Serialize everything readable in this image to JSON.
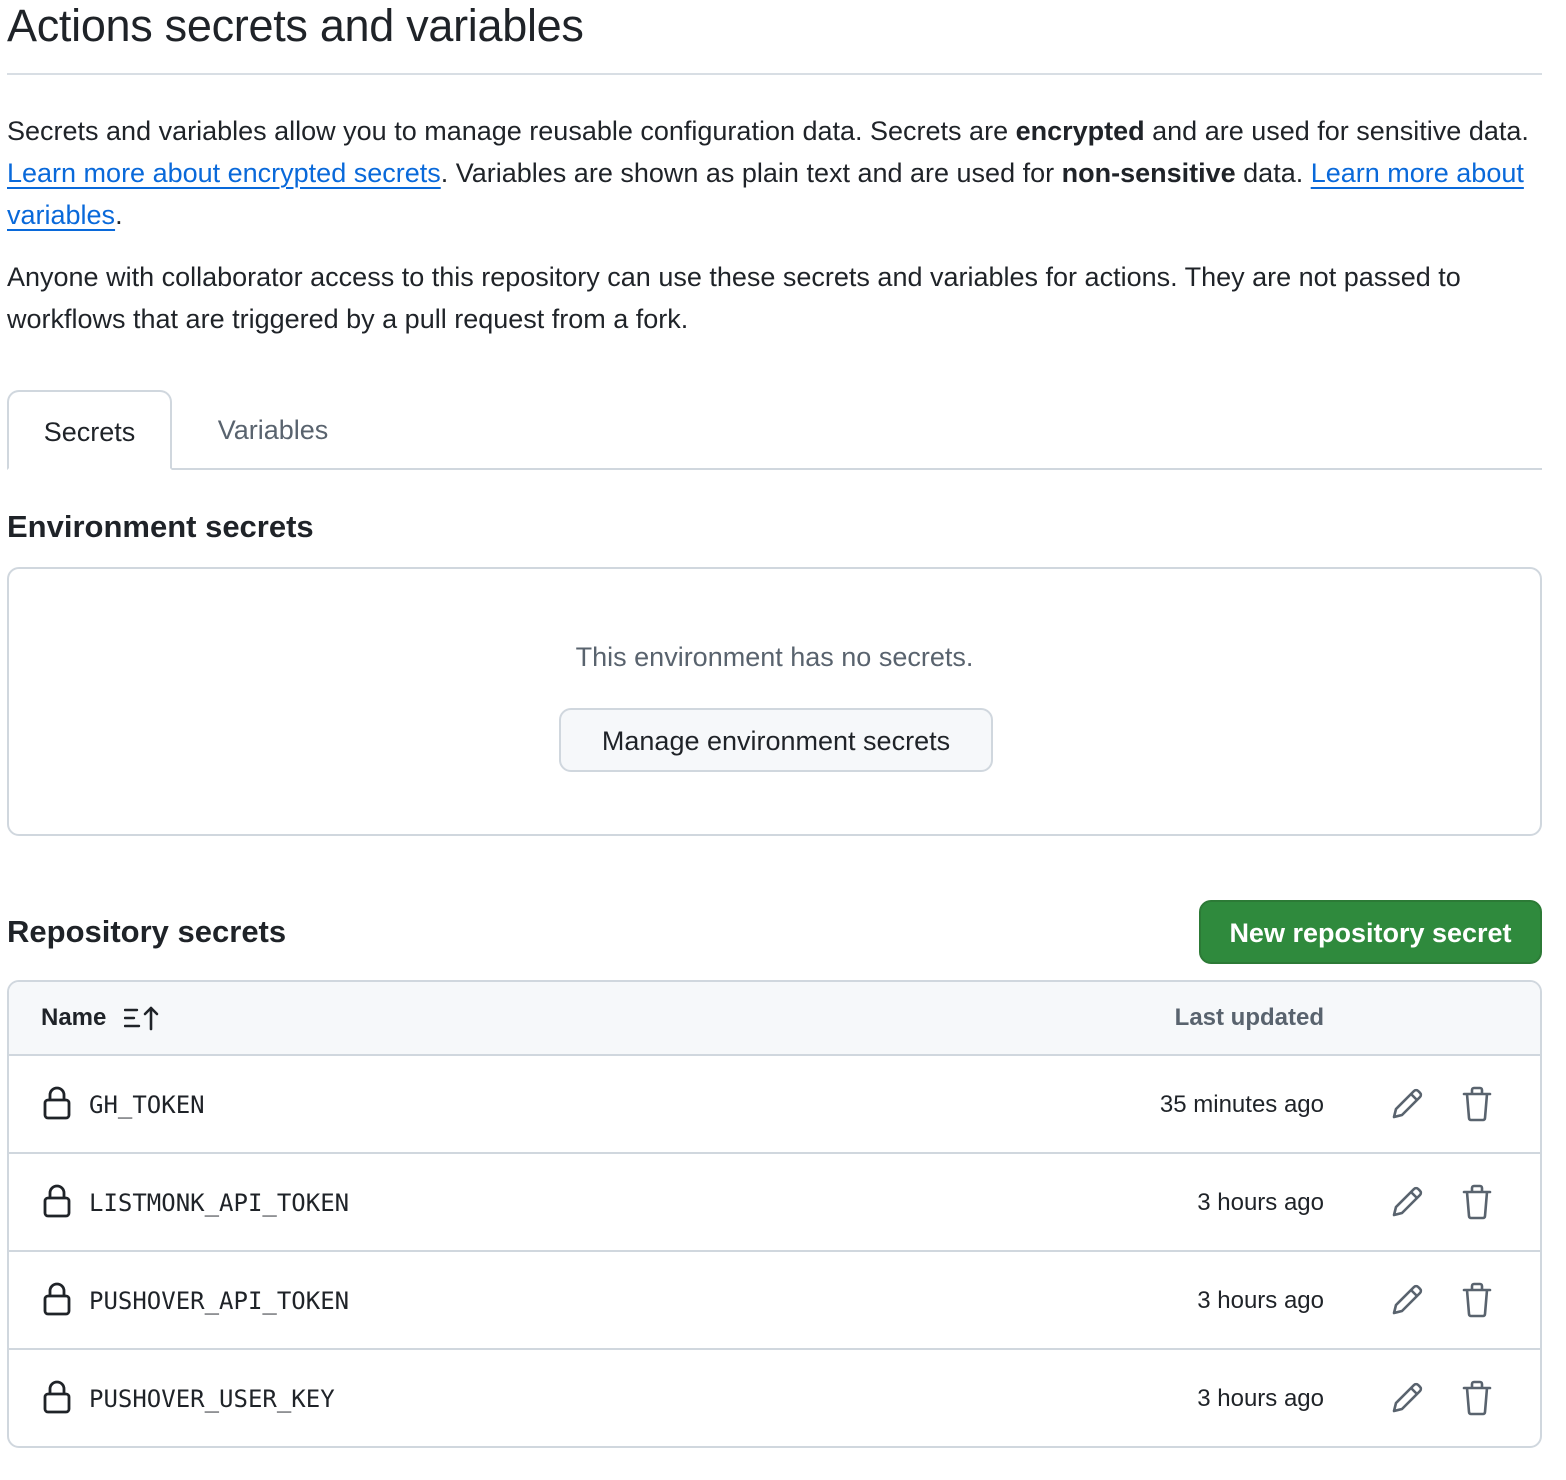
{
  "page": {
    "title": "Actions secrets and variables"
  },
  "intro": {
    "part1": "Secrets and variables allow you to manage reusable configuration data. Secrets are ",
    "bold1": "encrypted",
    "part2": " and are used for sensitive data. ",
    "link1": "Learn more about encrypted secrets",
    "part3": ". Variables are shown as plain text and are used for ",
    "bold2": "non-sensitive",
    "part4": " data. ",
    "link2": "Learn more about variables",
    "part5": "."
  },
  "access_note": "Anyone with collaborator access to this repository can use these secrets and variables for actions. They are not passed to workflows that are triggered by a pull request from a fork.",
  "tabs": [
    {
      "label": "Secrets",
      "selected": true
    },
    {
      "label": "Variables",
      "selected": false
    }
  ],
  "environment": {
    "title": "Environment secrets",
    "empty_message": "This environment has no secrets.",
    "manage_button": "Manage environment secrets"
  },
  "repository": {
    "title": "Repository secrets",
    "new_button": "New repository secret",
    "columns": {
      "name": "Name",
      "last_updated": "Last updated"
    },
    "sort_icon": "sort-ascending-icon",
    "rows": [
      {
        "name": "GH_TOKEN",
        "updated": "35 minutes ago"
      },
      {
        "name": "LISTMONK_API_TOKEN",
        "updated": "3 hours ago"
      },
      {
        "name": "PUSHOVER_API_TOKEN",
        "updated": "3 hours ago"
      },
      {
        "name": "PUSHOVER_USER_KEY",
        "updated": "3 hours ago"
      }
    ],
    "row_icons": {
      "lock": "lock-icon",
      "edit": "pencil-icon",
      "delete": "trash-icon"
    }
  },
  "colors": {
    "link": "#0969da",
    "primary_button": "#2f8a3d",
    "border": "#d0d7de",
    "muted_text": "#59636e"
  }
}
